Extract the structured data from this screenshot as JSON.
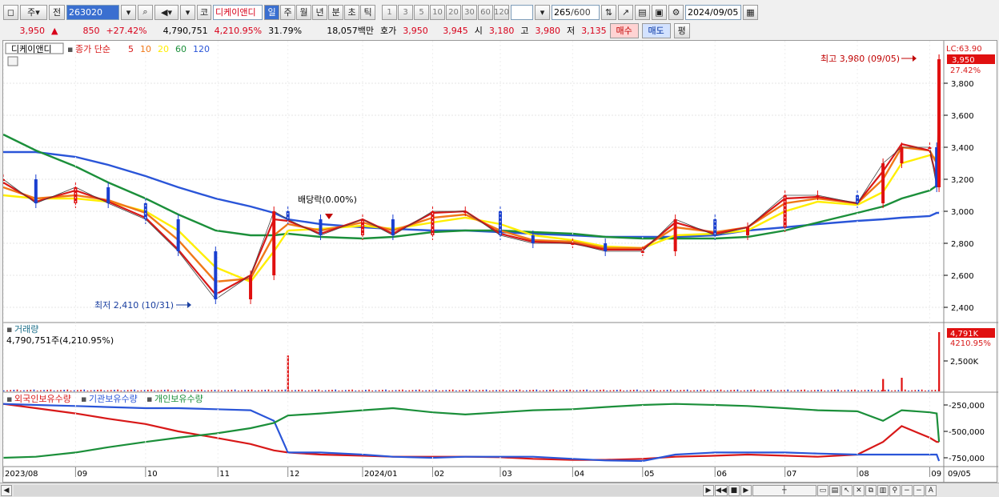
{
  "toolbar": {
    "market": "주",
    "prev": "전",
    "code": "263020",
    "ko_label": "코",
    "name": "디케이앤디",
    "periods": [
      "일",
      "주",
      "월",
      "년",
      "분",
      "초",
      "틱"
    ],
    "active_period": "일",
    "intervals": [
      "1",
      "3",
      "5",
      "10",
      "20",
      "30",
      "60",
      "120"
    ],
    "count": "265",
    "total": "/600",
    "date": "2024/09/05"
  },
  "quote": {
    "price": "3,950",
    "arrow": "▲",
    "change": "850",
    "change_pct": "+27.42%",
    "volume": "4,790,751",
    "volume_pct": "4,210.95%",
    "turnover": "31.79%",
    "amount": "18,057백만",
    "hoga_label": "호가",
    "ask": "3,950",
    "bid": "3,945",
    "open_label": "시",
    "open": "3,180",
    "high_label": "고",
    "high": "3,980",
    "low_label": "저",
    "low": "3,135",
    "buy_label": "매수",
    "sell_label": "매도",
    "eval_label": "평"
  },
  "price_panel": {
    "stock_name": "디케이앤디",
    "ma_title": "종가 단순",
    "ma_periods": [
      "5",
      "10",
      "20",
      "60",
      "120"
    ],
    "ma_colors": [
      "#d81818",
      "#f07818",
      "#ffee00",
      "#1b8f3a",
      "#2a55d8"
    ],
    "lc": "LC:63.90",
    "current_tag": "3,950",
    "current_pct": "27.42%",
    "high_note": "최고 3,980 (09/05)",
    "low_note": "최저 2,410 (10/31)",
    "dividend_note": "배당락(0.00%)"
  },
  "volume_panel": {
    "title": "거래량",
    "value": "4,790,751주(4,210.95%)",
    "tag": "4,791K",
    "tag_pct": "4210.95%",
    "axis_label": "2,500K"
  },
  "holdings_panel": {
    "series_names": [
      "외국인보유수량",
      "기관보유수량",
      "개인보유수량"
    ],
    "series_colors": [
      "#d81818",
      "#2a55d8",
      "#1b8f3a"
    ]
  },
  "chart_data": {
    "type": "line",
    "title": "디케이앤디",
    "x_ticks": [
      "2023/08",
      "09",
      "10",
      "11",
      "12",
      "2024/01",
      "02",
      "03",
      "04",
      "05",
      "06",
      "07",
      "08",
      "09",
      "09/05"
    ],
    "price_axis": {
      "ticks": [
        2400,
        2600,
        2800,
        3000,
        3200,
        3400,
        3600,
        3800
      ],
      "ylim": [
        2300,
        4000
      ]
    },
    "price_series": {
      "name": "종가",
      "dates": [
        "2023-08-01",
        "2023-08-15",
        "2023-09-01",
        "2023-09-15",
        "2023-10-01",
        "2023-10-15",
        "2023-10-31",
        "2023-11-15",
        "2023-11-25",
        "2023-12-01",
        "2023-12-15",
        "2024-01-02",
        "2024-01-15",
        "2024-02-01",
        "2024-02-15",
        "2024-03-01",
        "2024-03-15",
        "2024-04-01",
        "2024-04-15",
        "2024-05-01",
        "2024-05-15",
        "2024-06-01",
        "2024-06-15",
        "2024-07-01",
        "2024-07-15",
        "2024-08-01",
        "2024-08-12",
        "2024-08-20",
        "2024-09-01",
        "2024-09-04",
        "2024-09-05"
      ],
      "values": [
        3200,
        3050,
        3150,
        3050,
        2950,
        2750,
        2450,
        2600,
        3000,
        2950,
        2850,
        2950,
        2850,
        3000,
        3000,
        2850,
        2800,
        2800,
        2750,
        2750,
        2950,
        2850,
        2900,
        3100,
        3100,
        3050,
        3300,
        3400,
        3400,
        3150,
        3950
      ]
    },
    "moving_averages": [
      {
        "name": "5",
        "values": [
          3180,
          3060,
          3130,
          3060,
          2960,
          2760,
          2480,
          2600,
          2950,
          2940,
          2860,
          2950,
          2860,
          2990,
          3000,
          2860,
          2810,
          2800,
          2760,
          2760,
          2930,
          2860,
          2900,
          3080,
          3090,
          3050,
          3250,
          3420,
          3380,
          3200,
          3250
        ]
      },
      {
        "name": "10",
        "values": [
          3150,
          3080,
          3100,
          3070,
          2990,
          2820,
          2560,
          2580,
          2850,
          2920,
          2880,
          2930,
          2880,
          2960,
          2980,
          2880,
          2820,
          2810,
          2770,
          2770,
          2900,
          2870,
          2900,
          3050,
          3080,
          3050,
          3200,
          3400,
          3380,
          3300,
          3300
        ]
      },
      {
        "name": "20",
        "values": [
          3100,
          3080,
          3080,
          3060,
          3000,
          2880,
          2650,
          2560,
          2750,
          2880,
          2890,
          2910,
          2890,
          2930,
          2960,
          2920,
          2850,
          2820,
          2780,
          2770,
          2850,
          2860,
          2880,
          3000,
          3060,
          3040,
          3120,
          3300,
          3350,
          3330,
          3330
        ]
      },
      {
        "name": "60",
        "values": [
          3480,
          3380,
          3280,
          3180,
          3080,
          2980,
          2880,
          2850,
          2850,
          2860,
          2840,
          2830,
          2840,
          2870,
          2880,
          2880,
          2870,
          2860,
          2840,
          2830,
          2830,
          2830,
          2840,
          2880,
          2930,
          2990,
          3030,
          3080,
          3130,
          3160,
          3180
        ]
      },
      {
        "name": "120",
        "values": [
          3370,
          3370,
          3340,
          3290,
          3220,
          3150,
          3080,
          3030,
          2990,
          2950,
          2920,
          2900,
          2890,
          2880,
          2880,
          2870,
          2860,
          2850,
          2840,
          2840,
          2840,
          2850,
          2880,
          2900,
          2920,
          2940,
          2950,
          2960,
          2970,
          2990,
          2990
        ]
      }
    ],
    "volume_series": {
      "name": "거래량",
      "unit": "K",
      "spikes": [
        {
          "date": "2023-12-01",
          "value": 2900
        },
        {
          "date": "2024-08-12",
          "value": 1000
        },
        {
          "date": "2024-08-20",
          "value": 1100
        },
        {
          "date": "2024-09-05",
          "value": 4791
        }
      ],
      "baseline": 150
    },
    "holdings_axis": {
      "ticks": [
        -250000,
        -500000,
        -750000
      ],
      "ylim": [
        -800000,
        -150000
      ]
    },
    "holdings_series": [
      {
        "name": "외국인보유수량",
        "values": [
          -240000,
          -280000,
          -330000,
          -380000,
          -430000,
          -500000,
          -560000,
          -620000,
          -680000,
          -700000,
          -720000,
          -730000,
          -740000,
          -740000,
          -740000,
          -745000,
          -760000,
          -770000,
          -770000,
          -760000,
          -740000,
          -730000,
          -720000,
          -730000,
          -740000,
          -720000,
          -600000,
          -450000,
          -560000,
          -600000,
          -600000
        ]
      },
      {
        "name": "기관보유수량",
        "values": [
          -240000,
          -250000,
          -260000,
          -270000,
          -280000,
          -280000,
          -290000,
          -300000,
          -400000,
          -700000,
          -700000,
          -720000,
          -740000,
          -750000,
          -740000,
          -740000,
          -740000,
          -760000,
          -775000,
          -780000,
          -720000,
          -700000,
          -700000,
          -700000,
          -710000,
          -720000,
          -720000,
          -720000,
          -720000,
          -720000,
          -780000
        ]
      },
      {
        "name": "개인보유수량",
        "values": [
          -750000,
          -740000,
          -700000,
          -650000,
          -600000,
          -560000,
          -520000,
          -470000,
          -420000,
          -350000,
          -330000,
          -300000,
          -280000,
          -320000,
          -340000,
          -320000,
          -300000,
          -290000,
          -270000,
          -250000,
          -240000,
          -250000,
          -260000,
          -280000,
          -300000,
          -310000,
          -400000,
          -300000,
          -320000,
          -330000,
          -600000
        ]
      }
    ]
  }
}
